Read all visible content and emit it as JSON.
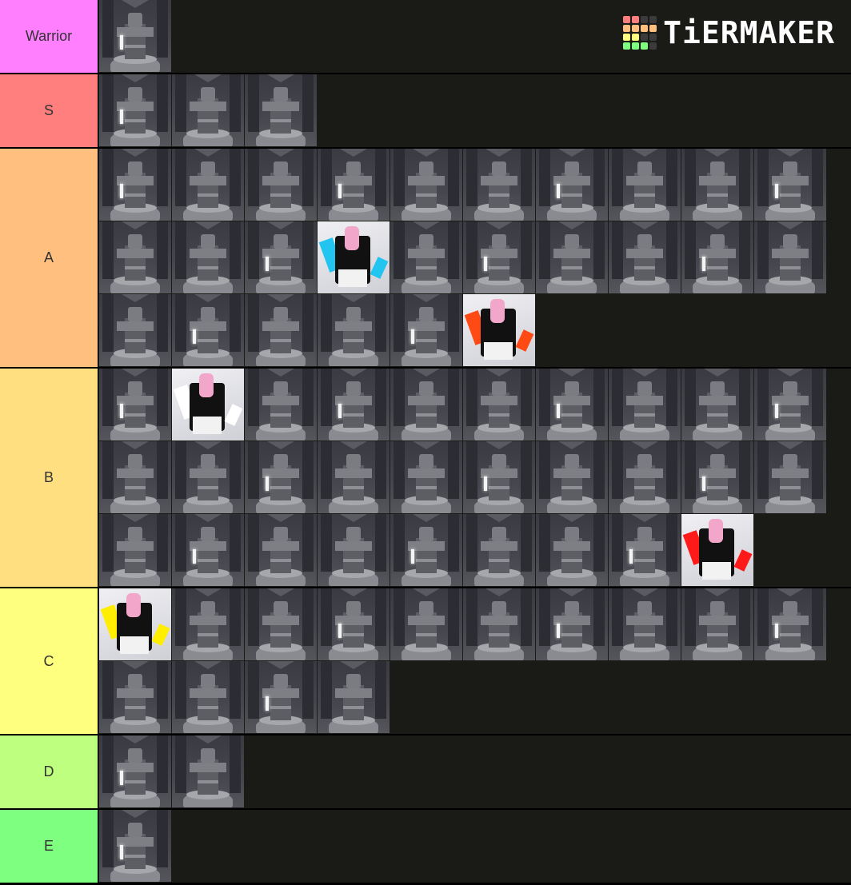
{
  "app": {
    "name": "TierMaker",
    "logo_text": "TiERMAKER"
  },
  "logo": {
    "grid_colors": [
      "#ff7f7f",
      "#ff7f7f",
      "#3b3b3b",
      "#3b3b3b",
      "#ffbf7f",
      "#ffbf7f",
      "#ffbf7f",
      "#ffbf7f",
      "#ffff7f",
      "#ffff7f",
      "#3b3b3b",
      "#3b3b3b",
      "#7fff7f",
      "#7fff7f",
      "#7fff7f",
      "#3b3b3b"
    ]
  },
  "tiers": [
    {
      "label": "Warrior",
      "color": "#ff7fff",
      "items": [
        {
          "type": "tower"
        }
      ]
    },
    {
      "label": "S",
      "color": "#ff7f7f",
      "items": [
        {
          "type": "tower"
        },
        {
          "type": "tower"
        },
        {
          "type": "tower"
        }
      ]
    },
    {
      "label": "A",
      "color": "#ffbf7f",
      "items": [
        {
          "type": "tower"
        },
        {
          "type": "tower"
        },
        {
          "type": "tower"
        },
        {
          "type": "tower"
        },
        {
          "type": "tower"
        },
        {
          "type": "tower"
        },
        {
          "type": "tower"
        },
        {
          "type": "tower"
        },
        {
          "type": "tower"
        },
        {
          "type": "tower"
        },
        {
          "type": "tower"
        },
        {
          "type": "tower"
        },
        {
          "type": "tower"
        },
        {
          "type": "avatar",
          "accent": "#22c4f0"
        },
        {
          "type": "tower"
        },
        {
          "type": "tower"
        },
        {
          "type": "tower"
        },
        {
          "type": "tower"
        },
        {
          "type": "tower"
        },
        {
          "type": "tower"
        },
        {
          "type": "tower"
        },
        {
          "type": "tower"
        },
        {
          "type": "tower"
        },
        {
          "type": "tower"
        },
        {
          "type": "tower"
        },
        {
          "type": "avatar",
          "accent": "#ff4a14"
        }
      ]
    },
    {
      "label": "B",
      "color": "#ffdf7f",
      "items": [
        {
          "type": "tower"
        },
        {
          "type": "avatar",
          "accent": "#ffffff"
        },
        {
          "type": "tower"
        },
        {
          "type": "tower"
        },
        {
          "type": "tower"
        },
        {
          "type": "tower"
        },
        {
          "type": "tower"
        },
        {
          "type": "tower"
        },
        {
          "type": "tower"
        },
        {
          "type": "tower"
        },
        {
          "type": "tower"
        },
        {
          "type": "tower"
        },
        {
          "type": "tower"
        },
        {
          "type": "tower"
        },
        {
          "type": "tower"
        },
        {
          "type": "tower"
        },
        {
          "type": "tower"
        },
        {
          "type": "tower"
        },
        {
          "type": "tower"
        },
        {
          "type": "tower"
        },
        {
          "type": "tower"
        },
        {
          "type": "tower"
        },
        {
          "type": "tower"
        },
        {
          "type": "tower"
        },
        {
          "type": "tower"
        },
        {
          "type": "tower"
        },
        {
          "type": "tower"
        },
        {
          "type": "tower"
        },
        {
          "type": "avatar",
          "accent": "#ff1a1a"
        }
      ]
    },
    {
      "label": "C",
      "color": "#ffff7f",
      "items": [
        {
          "type": "avatar",
          "accent": "#ffee00"
        },
        {
          "type": "tower"
        },
        {
          "type": "tower"
        },
        {
          "type": "tower"
        },
        {
          "type": "tower"
        },
        {
          "type": "tower"
        },
        {
          "type": "tower"
        },
        {
          "type": "tower"
        },
        {
          "type": "tower"
        },
        {
          "type": "tower"
        },
        {
          "type": "tower"
        },
        {
          "type": "tower"
        },
        {
          "type": "tower"
        },
        {
          "type": "tower"
        }
      ]
    },
    {
      "label": "D",
      "color": "#bfff7f",
      "items": [
        {
          "type": "tower"
        },
        {
          "type": "tower"
        }
      ]
    },
    {
      "label": "E",
      "color": "#7fff7f",
      "items": [
        {
          "type": "tower"
        }
      ]
    }
  ]
}
